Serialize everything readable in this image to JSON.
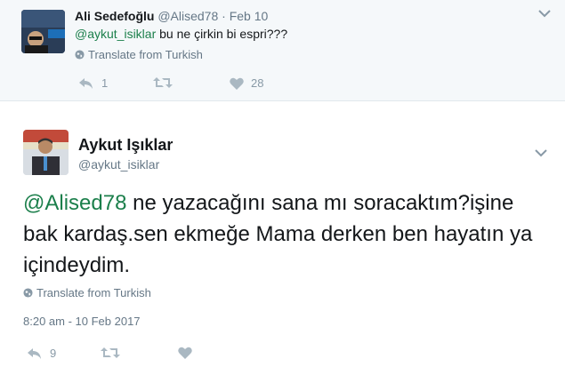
{
  "parent_tweet": {
    "display_name": "Ali Sedefoğlu",
    "handle": "@Alised78",
    "separator": "·",
    "date": "Feb 10",
    "mention": "@aykut_isiklar",
    "text": " bu ne çirkin bi espri???",
    "translate_label": "Translate from Turkish",
    "reply_count": "1",
    "retweet_count": "",
    "like_count": "28"
  },
  "main_tweet": {
    "display_name": "Aykut Işıklar",
    "handle": "@aykut_isiklar",
    "mention": "@Alised78",
    "text": " ne yazacağını sana mı soracaktım?işine bak kardaş.sen ekmeğe Mama derken ben hayatın ya içindeydim.",
    "translate_label": "Translate from Turkish",
    "timestamp": "8:20 am - 10 Feb 2017",
    "reply_count": "9",
    "retweet_count": "",
    "like_count": ""
  },
  "icons": [
    "globe-icon",
    "reply-icon",
    "retweet-icon",
    "heart-icon",
    "chevron-down-icon"
  ],
  "colors": {
    "mention": "#1b7f4b",
    "meta": "#657786",
    "icon": "#aab8c2",
    "top_bg": "#f5f8fa"
  }
}
